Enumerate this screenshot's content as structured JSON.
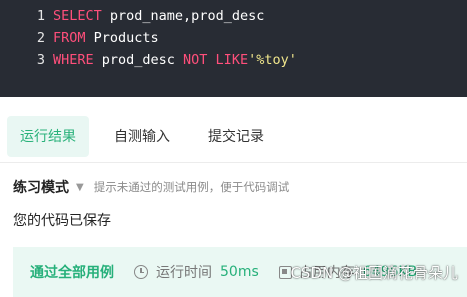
{
  "editor": {
    "lines": [
      {
        "num": "1",
        "tokens": [
          {
            "t": "SELECT",
            "c": "kw"
          },
          {
            "t": " prod_name,prod_desc",
            "c": "tx"
          }
        ]
      },
      {
        "num": "2",
        "tokens": [
          {
            "t": "FROM",
            "c": "kw"
          },
          {
            "t": " Products",
            "c": "tx"
          }
        ]
      },
      {
        "num": "3",
        "tokens": [
          {
            "t": "WHERE",
            "c": "kw"
          },
          {
            "t": " prod_desc ",
            "c": "tx"
          },
          {
            "t": "NOT LIKE",
            "c": "kw"
          },
          {
            "t": "'%toy'",
            "c": "str"
          }
        ]
      }
    ]
  },
  "tabs": [
    {
      "label": "运行结果",
      "active": true
    },
    {
      "label": "自测输入",
      "active": false
    },
    {
      "label": "提交记录",
      "active": false
    }
  ],
  "mode": {
    "label": "练习模式",
    "hint": "提示未通过的测试用例，便于代码调试"
  },
  "status": {
    "saved": "您的代码已保存"
  },
  "result": {
    "pass_label": "通过全部用例",
    "time_label": "运行时间",
    "time_value": "50ms",
    "memory_label": "占用内存",
    "memory_value": "6496KB"
  },
  "watermark": "CSDN @祖国滴花骨朵儿",
  "colors": {
    "editor_bg": "#282c34",
    "keyword": "#ff4f7b",
    "string": "#f0e68c",
    "accent_green": "#2ab27b",
    "result_bg": "#eaf8f3"
  }
}
